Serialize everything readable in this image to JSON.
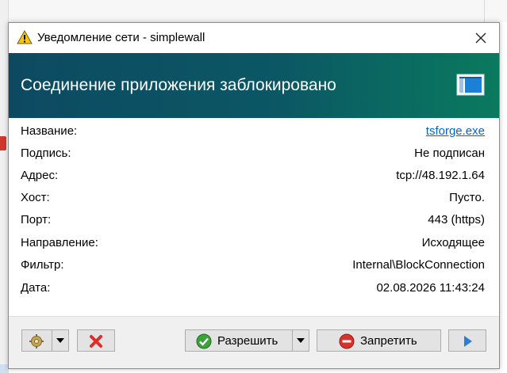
{
  "window": {
    "title": "Уведомление сети - simplewall"
  },
  "header": {
    "title": "Соединение приложения заблокировано"
  },
  "details": [
    {
      "label": "Название:",
      "value": "tsforge.exe",
      "link": true
    },
    {
      "label": "Подпись:",
      "value": "Не подписан"
    },
    {
      "label": "Адрес:",
      "value": "tcp://48.192.1.64"
    },
    {
      "label": "Хост:",
      "value": "Пусто."
    },
    {
      "label": "Порт:",
      "value": "443 (https)"
    },
    {
      "label": "Направление:",
      "value": "Исходящее"
    },
    {
      "label": "Фильтр:",
      "value": "Internal\\BlockConnection"
    },
    {
      "label": "Дата:",
      "value": "02.08.2026 11:43:24"
    }
  ],
  "buttons": {
    "allow_label": "Разрешить",
    "block_label": "Запретить"
  },
  "icons": {
    "warning": "warning-icon",
    "close": "close-icon",
    "window": "window-icon",
    "settings": "settings-gear-icon",
    "delete": "red-x-icon",
    "allow": "green-check-icon",
    "block": "red-no-entry-icon",
    "next": "play-arrow-icon",
    "dropdown": "chevron-down-icon"
  },
  "colors": {
    "header_start": "#0d4a62",
    "header_end": "#0a7a5e",
    "link": "#0066cc"
  }
}
